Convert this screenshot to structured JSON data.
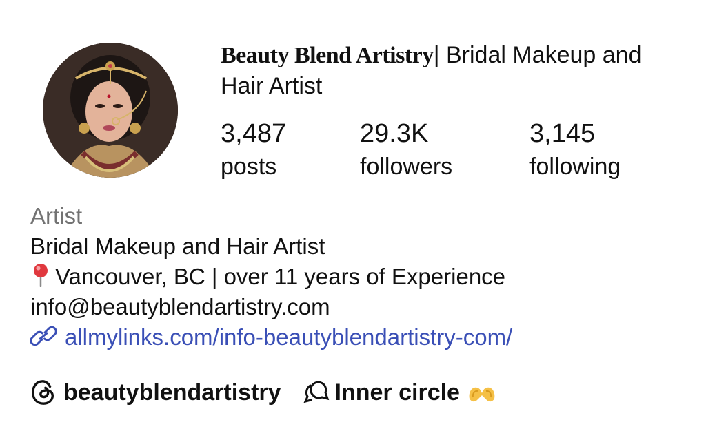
{
  "profile": {
    "name_brand": "Beauty Blend Artistry",
    "name_rest": "| Bridal Makeup and Hair Artist",
    "avatar_alt": "avatar"
  },
  "stats": {
    "posts": {
      "value": "3,487",
      "label": "posts"
    },
    "followers": {
      "value": "29.3K",
      "label": "followers"
    },
    "following": {
      "value": "3,145",
      "label": "following"
    }
  },
  "bio": {
    "category": "Artist",
    "line1": "Bridal Makeup and Hair Artist",
    "line2_icon": "pin-icon",
    "line2": "Vancouver, BC | over 11 years of Experience",
    "email": "info@beautyblendartistry.com",
    "link_icon": "link-icon",
    "link": "allmylinks.com/info-beautyblendartistry-com/"
  },
  "bottom": {
    "threads_icon": "threads-icon",
    "threads_handle": "beautyblendartistry",
    "circle_icon": "inner-circle-icon",
    "circle_label": "Inner circle",
    "emoji_icon": "heart-hands-icon"
  },
  "colors": {
    "link": "#3a4fb6",
    "category": "#737373",
    "text": "#111111",
    "pin": "#e0383e"
  }
}
